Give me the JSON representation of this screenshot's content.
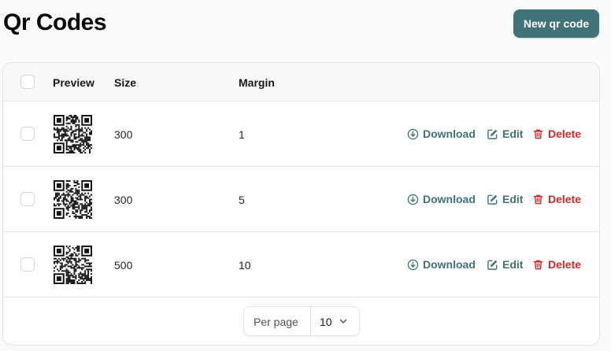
{
  "header": {
    "title": "Qr Codes",
    "new_button_label": "New qr code"
  },
  "table": {
    "columns": [
      "Preview",
      "Size",
      "Margin"
    ],
    "rows": [
      {
        "size": "300",
        "margin": "1"
      },
      {
        "size": "300",
        "margin": "5"
      },
      {
        "size": "500",
        "margin": "10"
      }
    ],
    "actions": {
      "download": "Download",
      "edit": "Edit",
      "delete": "Delete"
    }
  },
  "pagination": {
    "per_page_label": "Per page",
    "per_page_value": "10"
  },
  "colors": {
    "accent": "#3f7378",
    "danger": "#dc2626"
  },
  "icons": [
    "qr-code-icon",
    "download-icon",
    "edit-icon",
    "trash-icon",
    "chevron-down-icon"
  ]
}
